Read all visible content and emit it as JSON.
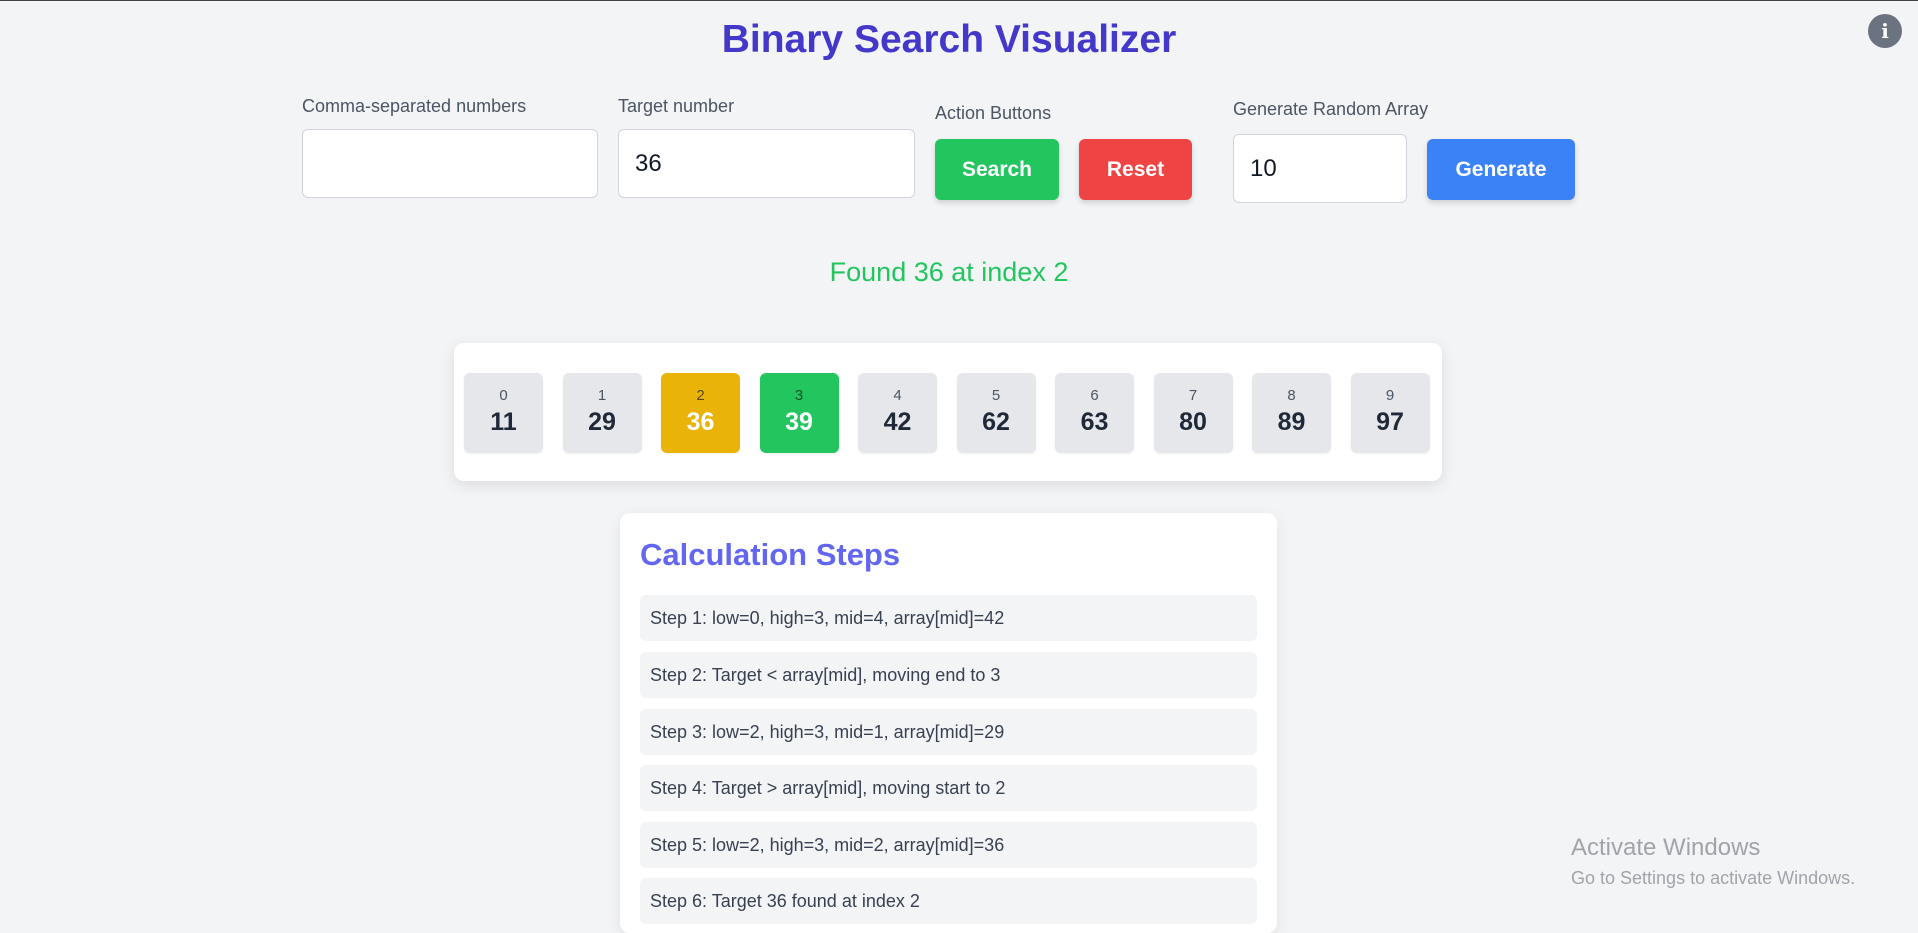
{
  "app": {
    "title": "Binary Search Visualizer",
    "info_icon": "i"
  },
  "inputs": {
    "numbers_label": "Comma-separated numbers",
    "numbers_value": "",
    "target_label": "Target number",
    "target_value": "36",
    "actions_label": "Action Buttons",
    "search_label": "Search",
    "reset_label": "Reset",
    "random_label": "Generate Random Array",
    "random_size_value": "10",
    "generate_label": "Generate"
  },
  "status": "Found 36 at index 2",
  "array": {
    "cells": [
      {
        "index": "0",
        "value": "11",
        "state": "default"
      },
      {
        "index": "1",
        "value": "29",
        "state": "default"
      },
      {
        "index": "2",
        "value": "36",
        "state": "mid"
      },
      {
        "index": "3",
        "value": "39",
        "state": "found"
      },
      {
        "index": "4",
        "value": "42",
        "state": "default"
      },
      {
        "index": "5",
        "value": "62",
        "state": "default"
      },
      {
        "index": "6",
        "value": "63",
        "state": "default"
      },
      {
        "index": "7",
        "value": "80",
        "state": "default"
      },
      {
        "index": "8",
        "value": "89",
        "state": "default"
      },
      {
        "index": "9",
        "value": "97",
        "state": "default"
      }
    ]
  },
  "steps": {
    "title": "Calculation Steps",
    "items": [
      "Step 1: low=0, high=3, mid=4, array[mid]=42",
      "Step 2: Target < array[mid], moving end to 3",
      "Step 3: low=2, high=3, mid=1, array[mid]=29",
      "Step 4: Target > array[mid], moving start to 2",
      "Step 5: low=2, high=3, mid=2, array[mid]=36",
      "Step 6: Target 36 found at index 2"
    ]
  },
  "watermark": {
    "line1": "Activate Windows",
    "line2": "Go to Settings to activate Windows."
  },
  "colors": {
    "title": "#4338ca",
    "search": "#22c55e",
    "reset": "#ef4444",
    "generate": "#3b82f6",
    "mid_cell": "#eab308",
    "found_cell": "#22c55e"
  }
}
